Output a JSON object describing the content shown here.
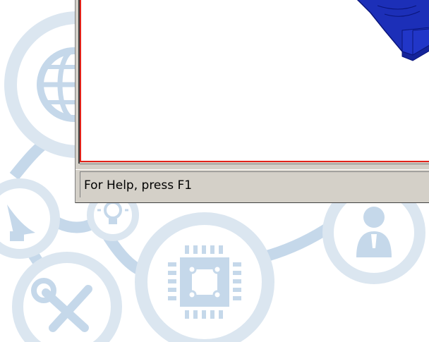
{
  "status_bar": {
    "help_text": "For Help, press F1"
  },
  "colors": {
    "view_border": "#e2231a",
    "model_fill": "#1c2fb8",
    "model_edge": "#0a157a",
    "window_face": "#d4d0c8",
    "background_icons": "#c5d8ea"
  },
  "icons": [
    "globe-icon",
    "satellite-dish-icon",
    "lightbulb-icon",
    "cpu-chip-icon",
    "tools-icon",
    "user-icon"
  ]
}
